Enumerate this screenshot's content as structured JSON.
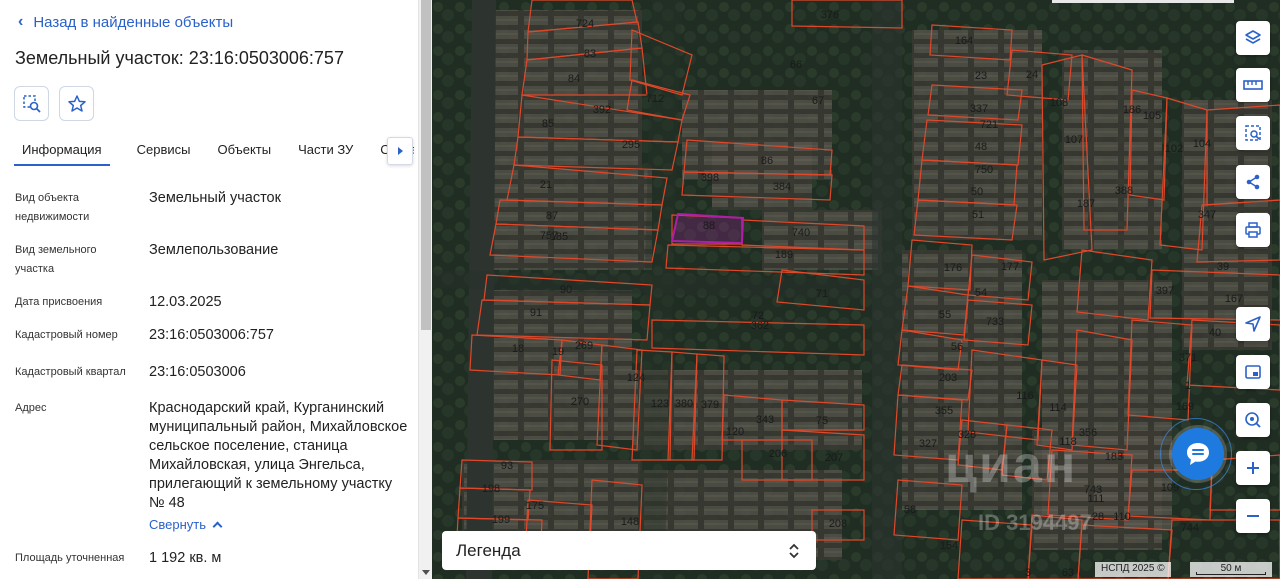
{
  "panel": {
    "back_label": "Назад в найденные объекты",
    "title": "Земельный участок: 23:16:0503006:757",
    "tabs": [
      "Информация",
      "Сервисы",
      "Объекты",
      "Части ЗУ",
      "Состав"
    ],
    "active_tab": "Информация",
    "fields": [
      {
        "label": "Вид объекта недвижимости",
        "value": "Земельный участок"
      },
      {
        "label": "Вид земельного участка",
        "value": "Землепользование"
      },
      {
        "label": "Дата присвоения",
        "value": "12.03.2025"
      },
      {
        "label": "Кадастровый номер",
        "value": "23:16:0503006:757"
      },
      {
        "label": "Кадастровый квартал",
        "value": "23:16:0503006"
      },
      {
        "label": "Адрес",
        "value": "Краснодарский край, Курганинский муниципальный район, Михайловское сельское поселение, станица Михайловская, улица Энгельса, прилегающий к земельному участку № 48"
      },
      {
        "label": "Площадь уточненная",
        "value": "1 192 кв. м"
      }
    ],
    "collapse_label": "Свернуть"
  },
  "map": {
    "legend_label": "Легенда",
    "attribution": "НСПД 2025 ©",
    "scale": "50 м",
    "watermark": "циан",
    "watermark_id": "ID 3194497",
    "selected_parcel": "757",
    "selected_color": "#b01ea8",
    "parcel_outline_color": "#e0482a",
    "parcel_labels": [
      "724",
      "376",
      "83",
      "66",
      "84",
      "712",
      "67",
      "392",
      "85",
      "295",
      "86",
      "398",
      "21",
      "384",
      "87",
      "88",
      "757",
      "740",
      "189",
      "185",
      "90",
      "71",
      "91",
      "72",
      "362",
      "18",
      "19",
      "269",
      "124",
      "270",
      "123",
      "380",
      "379",
      "120",
      "343",
      "75",
      "206",
      "207",
      "93",
      "198",
      "175",
      "148",
      "199",
      "208",
      "164",
      "23",
      "24",
      "337",
      "721",
      "48",
      "750",
      "50",
      "51",
      "108",
      "186",
      "105",
      "107",
      "104",
      "102",
      "187",
      "388",
      "347",
      "176",
      "177",
      "54",
      "55",
      "733",
      "56",
      "39",
      "397",
      "167",
      "40",
      "371",
      "1",
      "169",
      "203",
      "116",
      "114",
      "355",
      "327",
      "328",
      "118",
      "356",
      "183",
      "743",
      "111",
      "28",
      "110",
      "109",
      "744",
      "58",
      "154",
      "3",
      "63"
    ]
  },
  "controls": [
    "layers-icon",
    "ruler-icon",
    "select-area-icon",
    "share-icon",
    "print-icon",
    "locate-icon",
    "minimap-icon",
    "geo-search-icon",
    "zoom-in-icon",
    "zoom-out-icon"
  ]
}
